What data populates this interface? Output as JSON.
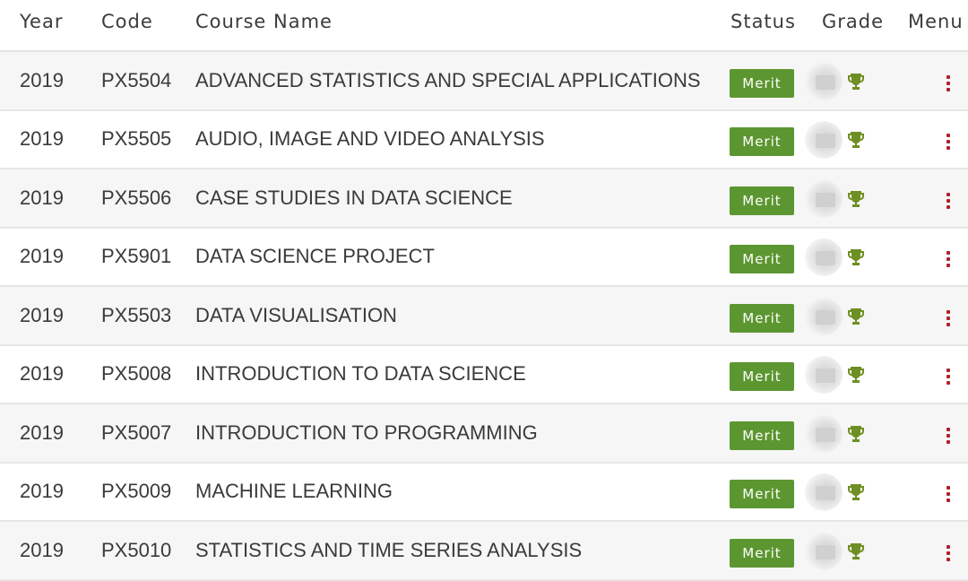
{
  "header": {
    "year": "Year",
    "code": "Code",
    "course_name": "Course Name",
    "status": "Status",
    "grade": "Grade",
    "menu": "Menu"
  },
  "colors": {
    "merit_badge": "#5c9630",
    "trophy": "#6e8f24",
    "menu_dots": "#b0202a"
  },
  "icons": {
    "grade_trophy": "trophy-icon",
    "row_menu": "kebab-menu-icon",
    "grade_blurred": "grade-redacted-icon"
  },
  "rows": [
    {
      "year": "2019",
      "code": "PX5504",
      "name": "ADVANCED STATISTICS AND SPECIAL APPLICATIONS",
      "status": "Merit"
    },
    {
      "year": "2019",
      "code": "PX5505",
      "name": "AUDIO, IMAGE AND VIDEO ANALYSIS",
      "status": "Merit"
    },
    {
      "year": "2019",
      "code": "PX5506",
      "name": "CASE STUDIES IN DATA SCIENCE",
      "status": "Merit"
    },
    {
      "year": "2019",
      "code": "PX5901",
      "name": "DATA SCIENCE PROJECT",
      "status": "Merit"
    },
    {
      "year": "2019",
      "code": "PX5503",
      "name": "DATA VISUALISATION",
      "status": "Merit"
    },
    {
      "year": "2019",
      "code": "PX5008",
      "name": "INTRODUCTION TO DATA SCIENCE",
      "status": "Merit"
    },
    {
      "year": "2019",
      "code": "PX5007",
      "name": "INTRODUCTION TO PROGRAMMING",
      "status": "Merit"
    },
    {
      "year": "2019",
      "code": "PX5009",
      "name": "MACHINE LEARNING",
      "status": "Merit"
    },
    {
      "year": "2019",
      "code": "PX5010",
      "name": "STATISTICS AND TIME SERIES ANALYSIS",
      "status": "Merit"
    }
  ]
}
